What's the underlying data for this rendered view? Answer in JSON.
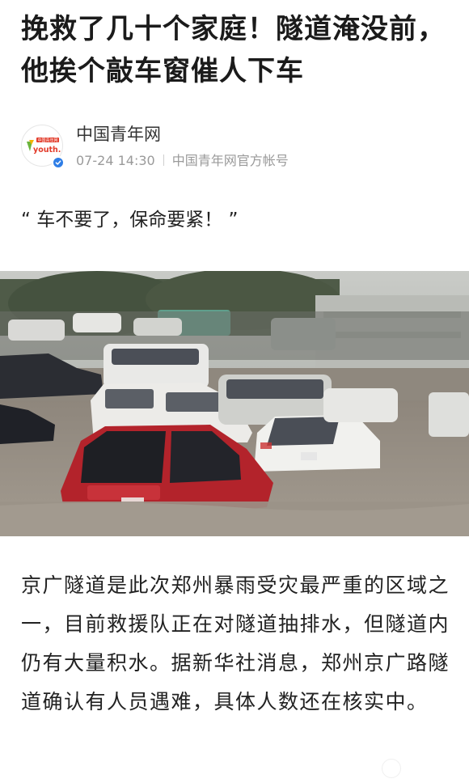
{
  "article": {
    "title": "挽救了几十个家庭！隧道淹没前，他挨个敲车窗催人下车",
    "quote": "“ 车不要了，保命要紧！ ”",
    "body": "京广隧道是此次郑州暴雨受灾最严重的区域之一，目前救援队正在对隧道抽排水，但隧道内仍有大量积水。据新华社消息，郑州京广路隧道确认有人员遇难，具体人数还在核实中。"
  },
  "author": {
    "name": "中国青年网",
    "time": "07-24 14:30",
    "account_type": "中国青年网官方帐号",
    "logo_text": "youth.cn",
    "logo_top_text": "中国青年网",
    "verified": true
  },
  "photo": {
    "subject": "flooded-road-cars"
  },
  "colors": {
    "title": "#1b1b1b",
    "meta": "#9a9a9a",
    "verified_badge": "#2f7ee6",
    "logo_accent": "#e23b2a"
  }
}
